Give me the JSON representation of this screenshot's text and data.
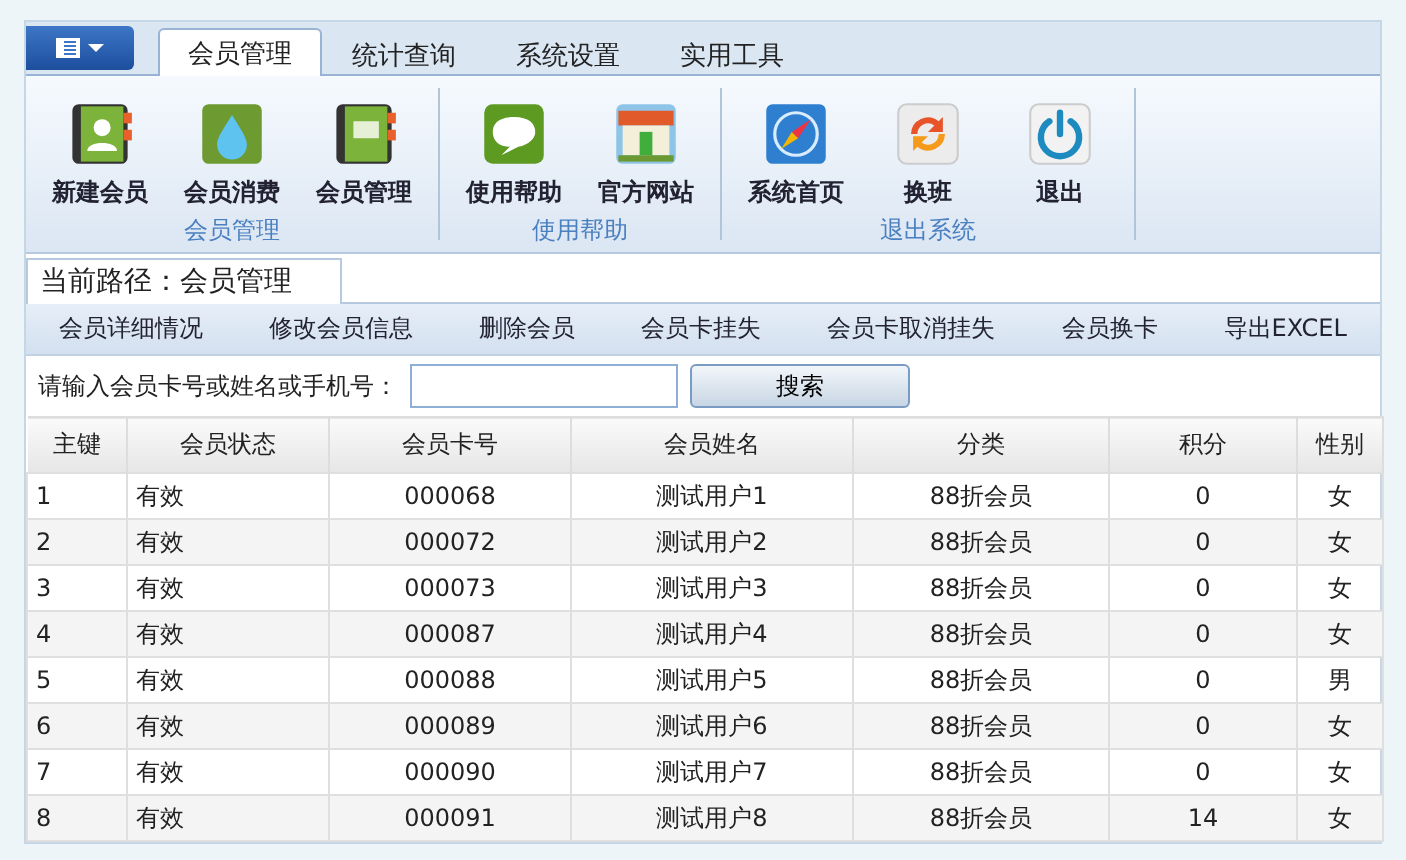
{
  "tabs": [
    {
      "label": "会员管理",
      "selected": true
    },
    {
      "label": "统计查询",
      "selected": false
    },
    {
      "label": "系统设置",
      "selected": false
    },
    {
      "label": "实用工具",
      "selected": false
    }
  ],
  "ribbon_groups": [
    {
      "label": "会员管理",
      "items": [
        {
          "label": "新建会员",
          "kind": "contact"
        },
        {
          "label": "会员消费",
          "kind": "drop"
        },
        {
          "label": "会员管理",
          "kind": "book"
        }
      ]
    },
    {
      "label": "使用帮助",
      "items": [
        {
          "label": "使用帮助",
          "kind": "chat"
        },
        {
          "label": "官方网站",
          "kind": "shop"
        }
      ]
    },
    {
      "label": "退出系统",
      "items": [
        {
          "label": "系统首页",
          "kind": "compass"
        },
        {
          "label": "换班",
          "kind": "swap"
        },
        {
          "label": "退出",
          "kind": "power"
        }
      ]
    }
  ],
  "breadcrumb": "当前路径：会员管理",
  "toolbar": [
    "会员详细情况",
    "修改会员信息",
    "删除会员",
    "会员卡挂失",
    "会员卡取消挂失",
    "会员换卡",
    "导出EXCEL"
  ],
  "search": {
    "label": "请输入会员卡号或姓名或手机号：",
    "button": "搜索"
  },
  "table": {
    "columns": [
      "主键",
      "会员状态",
      "会员卡号",
      "会员姓名",
      "分类",
      "积分",
      "性别"
    ],
    "rows": [
      [
        "1",
        "有效",
        "000068",
        "测试用户1",
        "88折会员",
        "0",
        "女"
      ],
      [
        "2",
        "有效",
        "000072",
        "测试用户2",
        "88折会员",
        "0",
        "女"
      ],
      [
        "3",
        "有效",
        "000073",
        "测试用户3",
        "88折会员",
        "0",
        "女"
      ],
      [
        "4",
        "有效",
        "000087",
        "测试用户4",
        "88折会员",
        "0",
        "女"
      ],
      [
        "5",
        "有效",
        "000088",
        "测试用户5",
        "88折会员",
        "0",
        "男"
      ],
      [
        "6",
        "有效",
        "000089",
        "测试用户6",
        "88折会员",
        "0",
        "女"
      ],
      [
        "7",
        "有效",
        "000090",
        "测试用户7",
        "88折会员",
        "0",
        "女"
      ],
      [
        "8",
        "有效",
        "000091",
        "测试用户8",
        "88折会员",
        "14",
        "女"
      ]
    ]
  }
}
